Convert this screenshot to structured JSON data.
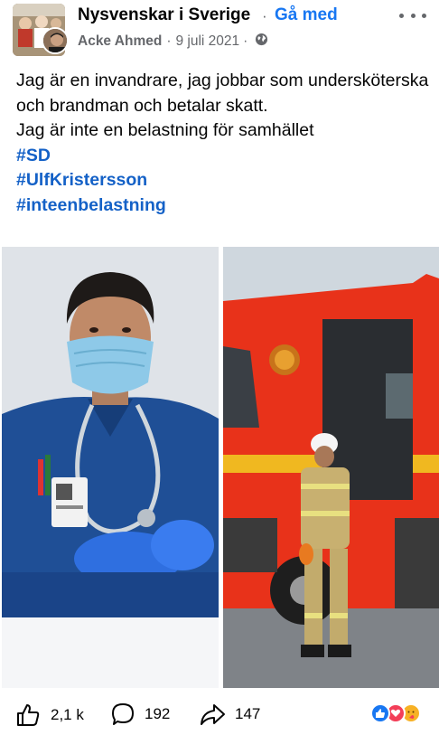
{
  "header": {
    "group_name": "Nysvenskar i Sverige",
    "separator": "·",
    "join_label": "Gå med",
    "author": "Acke Ahmed",
    "meta_separator": "·",
    "date": "9 juli 2021",
    "privacy_separator": "·",
    "privacy_icon": "globe-icon",
    "more_icon": "more-options-icon"
  },
  "post": {
    "line1": "Jag är en invandrare, jag jobbar som undersköterska och brandman och betalar skatt.",
    "line2": "Jag är inte en belastning för samhället",
    "hashtags": [
      "#SD",
      "#UlfKristersson",
      "#inteenbelastning"
    ]
  },
  "images": [
    {
      "description_icon": "nurse-photo"
    },
    {
      "description_icon": "firefighter-photo"
    }
  ],
  "footer": {
    "likes": "2,1 k",
    "comments": "192",
    "shares": "147",
    "like_icon": "thumbs-up-icon",
    "comment_icon": "comment-bubble-icon",
    "share_icon": "share-arrow-icon",
    "reaction_icons": [
      "like-reaction-icon",
      "love-reaction-icon",
      "care-reaction-icon"
    ]
  },
  "colors": {
    "link_blue": "#1877f2",
    "hashtag_blue": "#1461c7",
    "muted": "#65676b",
    "fire_truck_red": "#e8321a",
    "scrubs_blue": "#1f4f96"
  }
}
